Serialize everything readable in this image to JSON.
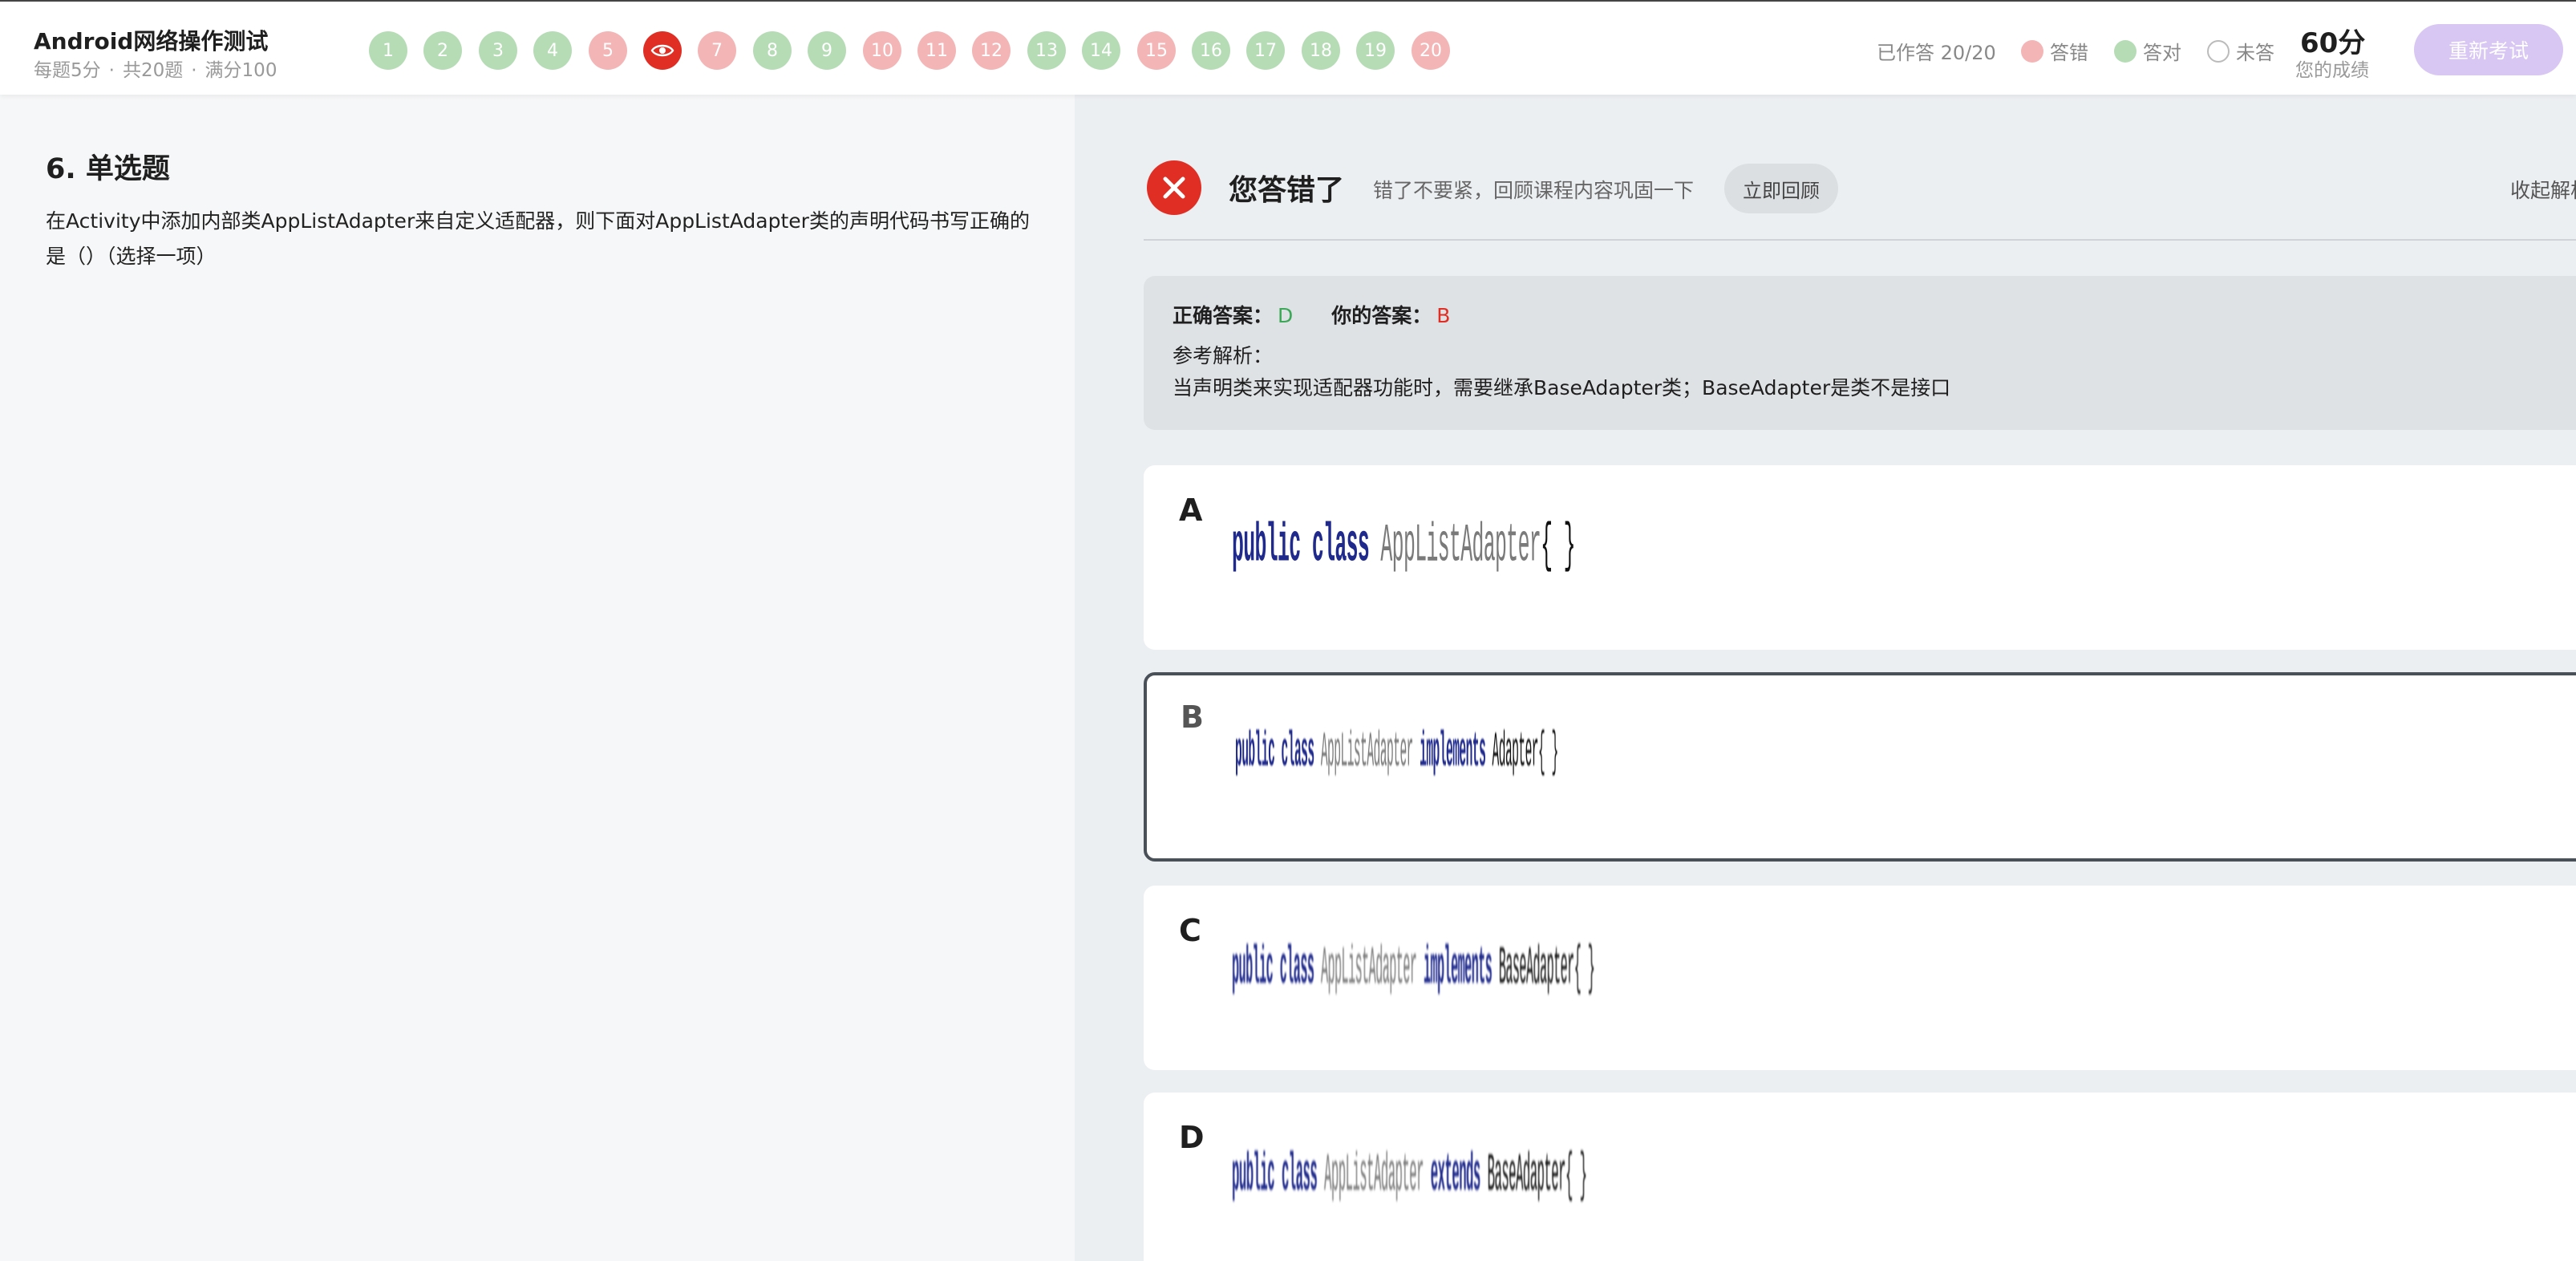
{
  "header": {
    "title": "Android网络操作测试",
    "meta": [
      "每题5分",
      "共20题",
      "满分100"
    ],
    "meta_separator": "·",
    "questions": [
      {
        "num": "1",
        "status": "correct"
      },
      {
        "num": "2",
        "status": "correct"
      },
      {
        "num": "3",
        "status": "correct"
      },
      {
        "num": "4",
        "status": "correct"
      },
      {
        "num": "5",
        "status": "wrong"
      },
      {
        "num": "6",
        "status": "current"
      },
      {
        "num": "7",
        "status": "wrong"
      },
      {
        "num": "8",
        "status": "correct"
      },
      {
        "num": "9",
        "status": "correct"
      },
      {
        "num": "10",
        "status": "wrong"
      },
      {
        "num": "11",
        "status": "wrong"
      },
      {
        "num": "12",
        "status": "wrong"
      },
      {
        "num": "13",
        "status": "correct"
      },
      {
        "num": "14",
        "status": "correct"
      },
      {
        "num": "15",
        "status": "wrong"
      },
      {
        "num": "16",
        "status": "correct"
      },
      {
        "num": "17",
        "status": "correct"
      },
      {
        "num": "18",
        "status": "correct"
      },
      {
        "num": "19",
        "status": "correct"
      },
      {
        "num": "20",
        "status": "wrong"
      }
    ],
    "answered_label": "已作答 20/20",
    "legend": {
      "wrong": "答错",
      "correct": "答对",
      "unanswered": "未答"
    },
    "score": "60分",
    "score_label": "您的成绩",
    "retake_label": "重新考试"
  },
  "question": {
    "title": "6. 单选题",
    "text": "在Activity中添加内部类AppListAdapter来自定义适配器，则下面对AppListAdapter类的声明代码书写正确的是（）（选择一项）"
  },
  "result": {
    "title": "您答错了",
    "subtitle": "错了不要紧，回顾课程内容巩固一下",
    "review_button": "立即回顾",
    "collapse_label": "收起解析",
    "correct_answer_label": "正确答案：",
    "correct_answer": "D",
    "your_answer_label": "你的答案：",
    "your_answer": "B",
    "analysis_label": "参考解析：",
    "analysis_text": "当声明类来实现适配器功能时，需要继承BaseAdapter类；BaseAdapter是类不是接口"
  },
  "options": [
    {
      "letter": "A",
      "code": {
        "kw": "public class",
        "cls": "AppListAdapter",
        "kw2": "",
        "base": "",
        "br": "{ }"
      }
    },
    {
      "letter": "B",
      "code": {
        "kw": "public class",
        "cls": "AppListAdapter",
        "kw2": "implements",
        "base": "Adapter",
        "br": "{ }"
      }
    },
    {
      "letter": "C",
      "code": {
        "kw": "public class",
        "cls": "AppListAdapter",
        "kw2": "implements",
        "base": "BaseAdapter",
        "br": "{ }"
      }
    },
    {
      "letter": "D",
      "code": {
        "kw": "public class",
        "cls": "AppListAdapter",
        "kw2": "extends",
        "base": "BaseAdapter",
        "br": "{ }"
      }
    }
  ],
  "selected_option": "B",
  "colors": {
    "correct": "#b6dcb6",
    "wrong": "#f3b5b5",
    "current": "#e02e24",
    "correct_answer_text": "#3aa856",
    "your_answer_text": "#e02e24",
    "retake_button": "#d8c6f3"
  },
  "icons": {
    "current_question": "eye-icon",
    "result": "close-icon"
  }
}
